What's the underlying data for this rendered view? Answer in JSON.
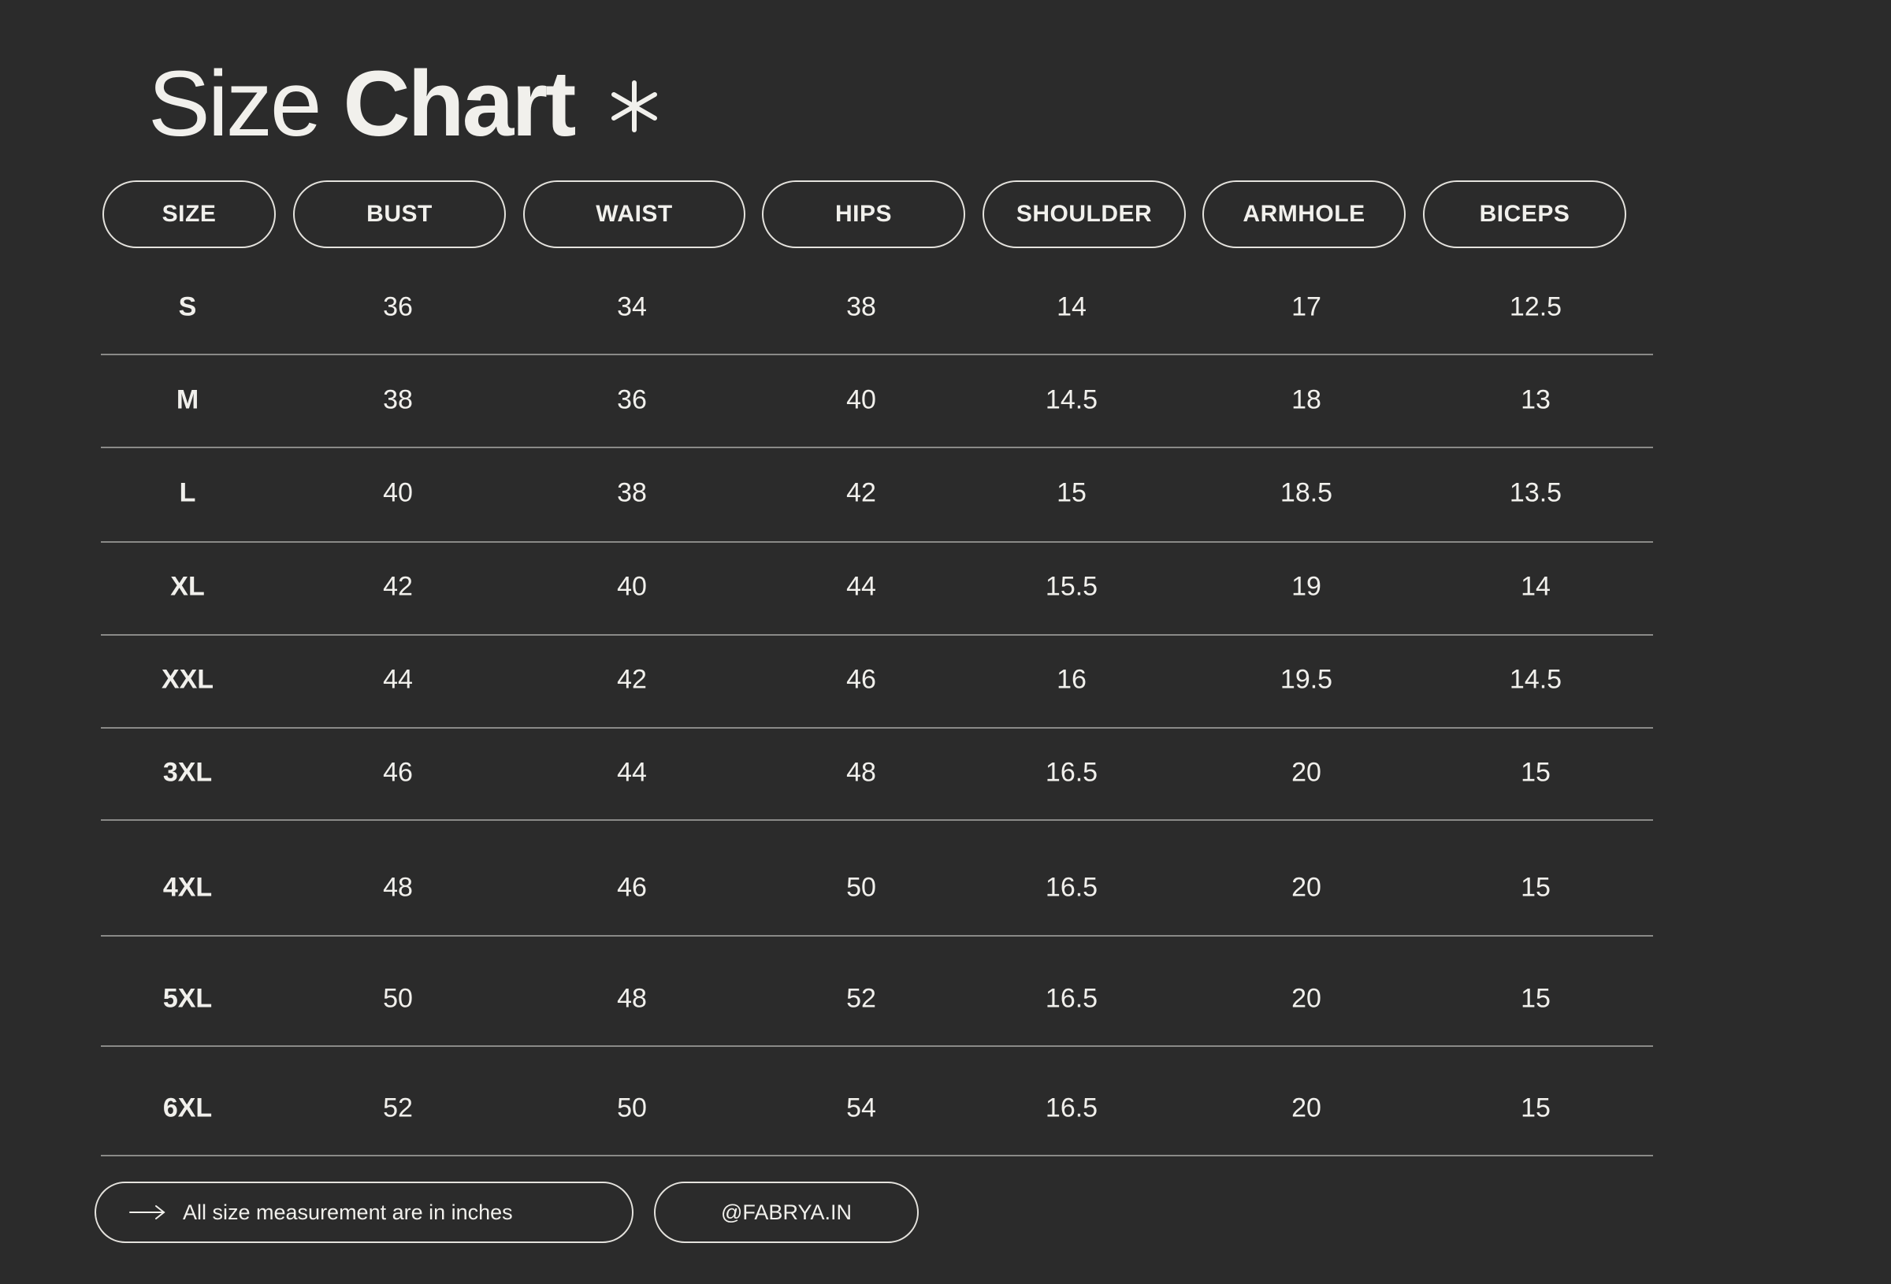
{
  "title": {
    "light": "Size",
    "bold": "Chart"
  },
  "icons": {
    "title_decoration": "asterisk-icon",
    "footer_note": "arrow-right-icon"
  },
  "headers": [
    "SIZE",
    "BUST",
    "WAIST",
    "HIPS",
    "SHOULDER",
    "ARMHOLE",
    "BICEPS"
  ],
  "rows": [
    [
      "S",
      "36",
      "34",
      "38",
      "14",
      "17",
      "12.5"
    ],
    [
      "M",
      "38",
      "36",
      "40",
      "14.5",
      "18",
      "13"
    ],
    [
      "L",
      "40",
      "38",
      "42",
      "15",
      "18.5",
      "13.5"
    ],
    [
      "XL",
      "42",
      "40",
      "44",
      "15.5",
      "19",
      "14"
    ],
    [
      "XXL",
      "44",
      "42",
      "46",
      "16",
      "19.5",
      "14.5"
    ],
    [
      "3XL",
      "46",
      "44",
      "48",
      "16.5",
      "20",
      "15"
    ],
    [
      "4XL",
      "48",
      "46",
      "50",
      "16.5",
      "20",
      "15"
    ],
    [
      "5XL",
      "50",
      "48",
      "52",
      "16.5",
      "20",
      "15"
    ],
    [
      "6XL",
      "52",
      "50",
      "54",
      "16.5",
      "20",
      "15"
    ]
  ],
  "footer": {
    "note": "All size measurement are in inches",
    "handle": "@FABRYA.IN"
  },
  "colors": {
    "background": "#2b2b2b",
    "text": "#f1f0ec",
    "border": "#e4e2dd",
    "rule": "#8a8a88"
  }
}
